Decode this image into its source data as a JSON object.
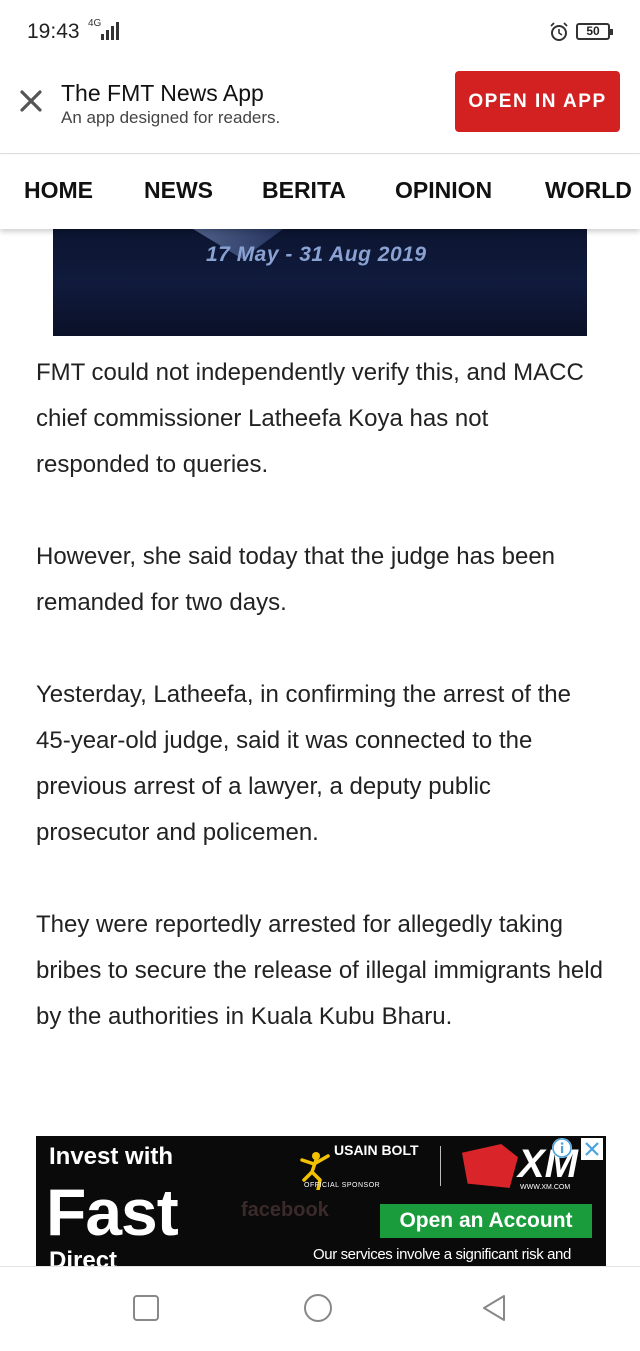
{
  "status_bar": {
    "time": "19:43",
    "network": "4G",
    "battery": "50"
  },
  "app_banner": {
    "title": "The FMT News App",
    "subtitle": "An app designed for readers.",
    "open_button": "OPEN IN APP",
    "button_color": "#d32121"
  },
  "nav": {
    "items": [
      "HOME",
      "NEWS",
      "BERITA",
      "OPINION",
      "WORLD"
    ]
  },
  "hero": {
    "date_text": "17 May - 31 Aug 2019"
  },
  "article": {
    "paragraphs": [
      "FMT could not independently verify this, and MACC chief commissioner Latheefa Koya has not responded to queries.",
      "However, she said today that the judge has been remanded for two days.",
      "Yesterday, Latheefa, in confirming the arrest of the 45-year-old judge, said it was connected to the previous arrest of a lawyer, a deputy public prosecutor and policemen.",
      "They were reportedly arrested for allegedly taking bribes to secure the release of illegal immigrants held by the authorities in Kuala Kubu Bharu."
    ]
  },
  "ad": {
    "line1": "Invest with",
    "line2": "Fast",
    "line3": "Direct",
    "bg_text": "facebook",
    "usain_text": "USAIN BOLT",
    "sponsor": "OFFICIAL SPONSOR",
    "brand": "XM",
    "url": "WWW.XM.COM",
    "cta": "Open an Account",
    "cta_color": "#1a9b3c",
    "disclaimer": "Our services involve a significant risk and"
  }
}
